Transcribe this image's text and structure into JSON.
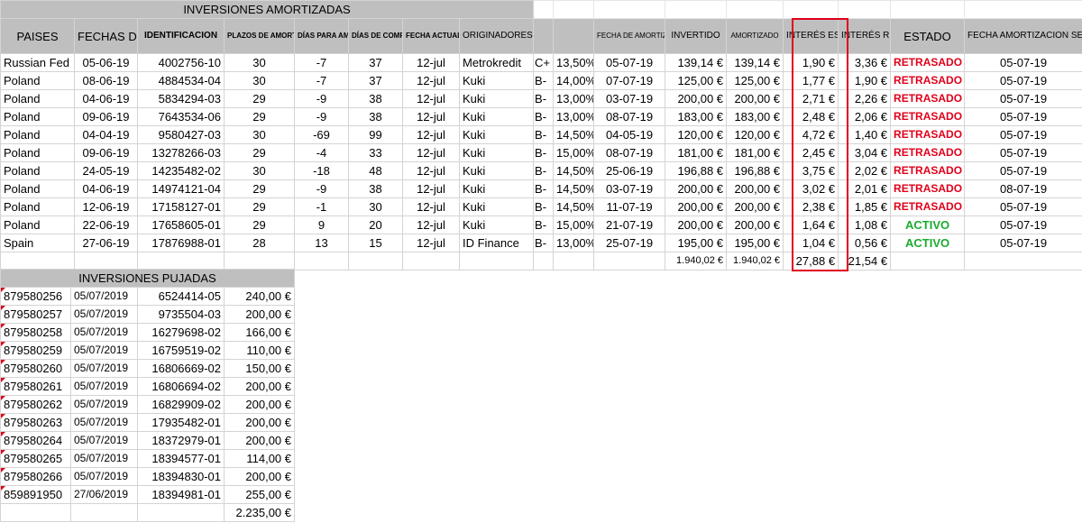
{
  "amortizadas": {
    "title": "INVERSIONES AMORTIZADAS",
    "headers": {
      "paises": "PAISES",
      "fechas": "FECHAS DE PUJA",
      "identificacion": "IDENTIFICACION",
      "plazos": "PLAZOS DE AMORTIZACION",
      "dias_amortizar": "DÍAS PARA AMORTIZAR",
      "dias_computo": "DÍAS DE COMPUTO",
      "fecha_actual": "FECHA ACTUAL SIN AMORTIZAR",
      "originadores": "ORIGINADORES",
      "fecha_esperada": "FECHA DE AMORTIZACION ESPERADA",
      "invertido": "INVERTIDO",
      "amortizado": "AMORTIZADO",
      "interes_esperado": "INTERÉS ESPERADO",
      "interes_recibido": "INTERÉS RECIBIDO",
      "estado": "ESTADO",
      "fecha_mintos": "FECHA AMORTIZACION SEGÚN MINTOS"
    },
    "rows": [
      {
        "pais": "Russian Fed",
        "fecha": "05-06-19",
        "id": "4002756-10",
        "plazo": "30",
        "dias_am": "-7",
        "dias_co": "37",
        "actual": "12-jul",
        "orig": "Metrokredit",
        "rating": "C+",
        "tasa": "13,50%",
        "esperada": "05-07-19",
        "invertido": "139,14 €",
        "amortizado": "139,14 €",
        "int_esp": "1,90 €",
        "int_rec": "3,36 €",
        "estado": "RETRASADO",
        "mintos": "05-07-19"
      },
      {
        "pais": "Poland",
        "fecha": "08-06-19",
        "id": "4884534-04",
        "plazo": "30",
        "dias_am": "-7",
        "dias_co": "37",
        "actual": "12-jul",
        "orig": "Kuki",
        "rating": "B-",
        "tasa": "14,00%",
        "esperada": "07-07-19",
        "invertido": "125,00 €",
        "amortizado": "125,00 €",
        "int_esp": "1,77 €",
        "int_rec": "1,90 €",
        "estado": "RETRASADO",
        "mintos": "05-07-19"
      },
      {
        "pais": "Poland",
        "fecha": "04-06-19",
        "id": "5834294-03",
        "plazo": "29",
        "dias_am": "-9",
        "dias_co": "38",
        "actual": "12-jul",
        "orig": "Kuki",
        "rating": "B-",
        "tasa": "13,00%",
        "esperada": "03-07-19",
        "invertido": "200,00 €",
        "amortizado": "200,00 €",
        "int_esp": "2,71 €",
        "int_rec": "2,26 €",
        "estado": "RETRASADO",
        "mintos": "05-07-19"
      },
      {
        "pais": "Poland",
        "fecha": "09-06-19",
        "id": "7643534-06",
        "plazo": "29",
        "dias_am": "-9",
        "dias_co": "38",
        "actual": "12-jul",
        "orig": "Kuki",
        "rating": "B-",
        "tasa": "13,00%",
        "esperada": "08-07-19",
        "invertido": "183,00 €",
        "amortizado": "183,00 €",
        "int_esp": "2,48 €",
        "int_rec": "2,06 €",
        "estado": "RETRASADO",
        "mintos": "05-07-19"
      },
      {
        "pais": "Poland",
        "fecha": "04-04-19",
        "id": "9580427-03",
        "plazo": "30",
        "dias_am": "-69",
        "dias_co": "99",
        "actual": "12-jul",
        "orig": "Kuki",
        "rating": "B-",
        "tasa": "14,50%",
        "esperada": "04-05-19",
        "invertido": "120,00 €",
        "amortizado": "120,00 €",
        "int_esp": "4,72 €",
        "int_rec": "1,40 €",
        "estado": "RETRASADO",
        "mintos": "05-07-19"
      },
      {
        "pais": "Poland",
        "fecha": "09-06-19",
        "id": "13278266-03",
        "plazo": "29",
        "dias_am": "-4",
        "dias_co": "33",
        "actual": "12-jul",
        "orig": "Kuki",
        "rating": "B-",
        "tasa": "15,00%",
        "esperada": "08-07-19",
        "invertido": "181,00 €",
        "amortizado": "181,00 €",
        "int_esp": "2,45 €",
        "int_rec": "3,04 €",
        "estado": "RETRASADO",
        "mintos": "05-07-19"
      },
      {
        "pais": "Poland",
        "fecha": "24-05-19",
        "id": "14235482-02",
        "plazo": "30",
        "dias_am": "-18",
        "dias_co": "48",
        "actual": "12-jul",
        "orig": "Kuki",
        "rating": "B-",
        "tasa": "14,50%",
        "esperada": "25-06-19",
        "invertido": "196,88 €",
        "amortizado": "196,88 €",
        "int_esp": "3,75 €",
        "int_rec": "2,02 €",
        "estado": "RETRASADO",
        "mintos": "05-07-19"
      },
      {
        "pais": "Poland",
        "fecha": "04-06-19",
        "id": "14974121-04",
        "plazo": "29",
        "dias_am": "-9",
        "dias_co": "38",
        "actual": "12-jul",
        "orig": "Kuki",
        "rating": "B-",
        "tasa": "14,50%",
        "esperada": "03-07-19",
        "invertido": "200,00 €",
        "amortizado": "200,00 €",
        "int_esp": "3,02 €",
        "int_rec": "2,01 €",
        "estado": "RETRASADO",
        "mintos": "08-07-19"
      },
      {
        "pais": "Poland",
        "fecha": "12-06-19",
        "id": "17158127-01",
        "plazo": "29",
        "dias_am": "-1",
        "dias_co": "30",
        "actual": "12-jul",
        "orig": "Kuki",
        "rating": "B-",
        "tasa": "14,50%",
        "esperada": "11-07-19",
        "invertido": "200,00 €",
        "amortizado": "200,00 €",
        "int_esp": "2,38 €",
        "int_rec": "1,85 €",
        "estado": "RETRASADO",
        "mintos": "05-07-19"
      },
      {
        "pais": "Poland",
        "fecha": "22-06-19",
        "id": "17658605-01",
        "plazo": "29",
        "dias_am": "9",
        "dias_co": "20",
        "actual": "12-jul",
        "orig": "Kuki",
        "rating": "B-",
        "tasa": "15,00%",
        "esperada": "21-07-19",
        "invertido": "200,00 €",
        "amortizado": "200,00 €",
        "int_esp": "1,64 €",
        "int_rec": "1,08 €",
        "estado": "ACTIVO",
        "mintos": "05-07-19"
      },
      {
        "pais": "Spain",
        "fecha": "27-06-19",
        "id": "17876988-01",
        "plazo": "28",
        "dias_am": "13",
        "dias_co": "15",
        "actual": "12-jul",
        "orig": "ID Finance",
        "rating": "B-",
        "tasa": "13,00%",
        "esperada": "25-07-19",
        "invertido": "195,00 €",
        "amortizado": "195,00 €",
        "int_esp": "1,04 €",
        "int_rec": "0,56 €",
        "estado": "ACTIVO",
        "mintos": "05-07-19"
      }
    ],
    "totals": {
      "invertido": "1.940,02 €",
      "amortizado": "1.940,02 €",
      "int_esp": "27,88 €",
      "int_rec": "21,54 €"
    }
  },
  "pujadas": {
    "title": "INVERSIONES PUJADAS",
    "rows": [
      {
        "ref": "879580256",
        "fecha": "05/07/2019",
        "id": "6524414-05",
        "importe": "240,00 €"
      },
      {
        "ref": "879580257",
        "fecha": "05/07/2019",
        "id": "9735504-03",
        "importe": "200,00 €"
      },
      {
        "ref": "879580258",
        "fecha": "05/07/2019",
        "id": "16279698-02",
        "importe": "166,00 €"
      },
      {
        "ref": "879580259",
        "fecha": "05/07/2019",
        "id": "16759519-02",
        "importe": "110,00 €"
      },
      {
        "ref": "879580260",
        "fecha": "05/07/2019",
        "id": "16806669-02",
        "importe": "150,00 €"
      },
      {
        "ref": "879580261",
        "fecha": "05/07/2019",
        "id": "16806694-02",
        "importe": "200,00 €"
      },
      {
        "ref": "879580262",
        "fecha": "05/07/2019",
        "id": "16829909-02",
        "importe": "200,00 €"
      },
      {
        "ref": "879580263",
        "fecha": "05/07/2019",
        "id": "17935482-01",
        "importe": "200,00 €"
      },
      {
        "ref": "879580264",
        "fecha": "05/07/2019",
        "id": "18372979-01",
        "importe": "200,00 €"
      },
      {
        "ref": "879580265",
        "fecha": "05/07/2019",
        "id": "18394577-01",
        "importe": "114,00 €"
      },
      {
        "ref": "879580266",
        "fecha": "05/07/2019",
        "id": "18394830-01",
        "importe": "200,00 €"
      },
      {
        "ref": "859891950",
        "fecha": "27/06/2019",
        "id": "18394981-01",
        "importe": "255,00 €"
      }
    ],
    "total": "2.235,00 €"
  },
  "colors": {
    "header_bg": "#bfbfbf",
    "late": "#e0001a",
    "active": "#1bab2e",
    "highlight_border": "#e0001a"
  }
}
